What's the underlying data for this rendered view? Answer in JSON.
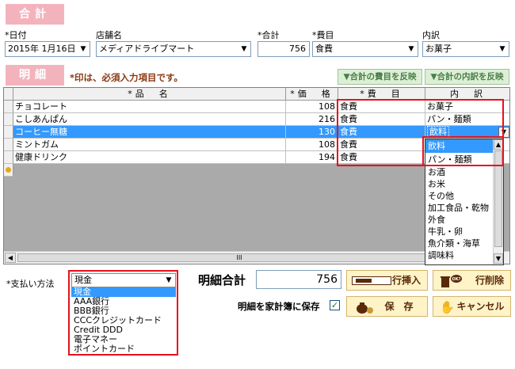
{
  "total_section": {
    "tab_label": "合計",
    "date_label": "*日付",
    "date_value": "2015年  1月16日",
    "store_label": "店舗名",
    "store_value": "メディアドライブマート",
    "total_label": "*合計",
    "total_value": "756",
    "expense_label": "*費目",
    "expense_value": "食費",
    "breakdown_label": "内訳",
    "breakdown_value": "お菓子"
  },
  "detail_section": {
    "tab_label": "明細",
    "note": "*印は、必須入力項目です。",
    "reflect_expense_button": "▼合計の費目を反映",
    "reflect_breakdown_button": "▼合計の内訳を反映",
    "columns": [
      "*品　名",
      "*価　格",
      "*費　目",
      "内　訳"
    ],
    "rows": [
      {
        "name": "チョコレート",
        "price": "108",
        "expense": "食費",
        "breakdown": "お菓子"
      },
      {
        "name": "こしあんぱん",
        "price": "216",
        "expense": "食費",
        "breakdown": "パン・麺類"
      },
      {
        "name": "コーヒー無糖",
        "price": "130",
        "expense": "食費",
        "breakdown": "飲料"
      },
      {
        "name": "ミントガム",
        "price": "108",
        "expense": "食費",
        "breakdown": ""
      },
      {
        "name": "健康ドリンク",
        "price": "194",
        "expense": "食費",
        "breakdown": ""
      }
    ],
    "breakdown_options": [
      "飲料",
      "パン・麺類",
      "お酒",
      "お米",
      "その他",
      "加工食品・乾物",
      "外食",
      "牛乳・卵",
      "魚介類・海草",
      "調味料"
    ],
    "scroll_mark": "III"
  },
  "payment": {
    "label": "*支払い方法",
    "value": "現金",
    "options": [
      "現金",
      "AAA銀行",
      "BBB銀行",
      "CCCクレジットカード",
      "Credit DDD",
      "電子マネー",
      "ポイントカード"
    ]
  },
  "detail_total": {
    "label": "明細合計",
    "value": "756"
  },
  "save_to_book": {
    "label": "明細を家計簿に保存",
    "checked": true
  },
  "buttons": {
    "insert_row": "行挿入",
    "delete_row": "行削除",
    "save": "保　存",
    "cancel": "キャンセル"
  },
  "colors": {
    "tab_pink": "#f3b3bd",
    "note_brown": "#8b3a12",
    "selection_blue": "#3399ff",
    "highlight_red": "#e8101c"
  }
}
